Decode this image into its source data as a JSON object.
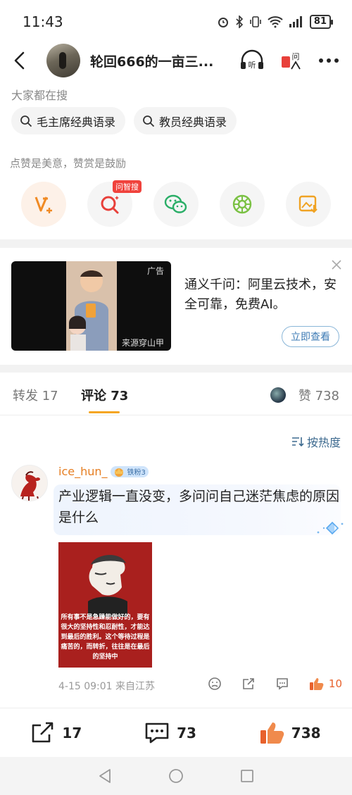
{
  "status_bar": {
    "time": "11:43",
    "battery": "81"
  },
  "header": {
    "title": "轮回666的一亩三..."
  },
  "search": {
    "label": "大家都在搜",
    "chips": [
      "毛主席经典语录",
      "教员经典语录"
    ]
  },
  "reward": {
    "label": "点赞是美意，赞赏是鼓励",
    "badge": "问智搜"
  },
  "ad": {
    "tag": "广告",
    "source": "来源穿山甲",
    "text": "通义千问：阿里云技术，安全可靠，免费AI。",
    "button": "立即查看"
  },
  "tabs": {
    "repost": "转发 17",
    "comment": "评论 73",
    "like": "赞 738"
  },
  "sort": {
    "label": "按热度"
  },
  "comment": {
    "username": "ice_hun_",
    "fan_badge": "铁粉3",
    "text": "产业逻辑一直没变，多问问自己迷茫焦虑的原因是什么",
    "image_text": "所有事不是急躁能做好的，要有很大的坚持性和忍耐性，才能达到最后的胜利。这个等待过程是痛苦的，而转折，往往是在最后的坚持中",
    "meta": "4-15 09:01  来自江苏",
    "likes": "10"
  },
  "bottom_bar": {
    "reposts": "17",
    "comments": "73",
    "likes": "738"
  },
  "colors": {
    "accent": "#f5a623",
    "like": "#e8612c",
    "link": "#3d6a8f"
  }
}
